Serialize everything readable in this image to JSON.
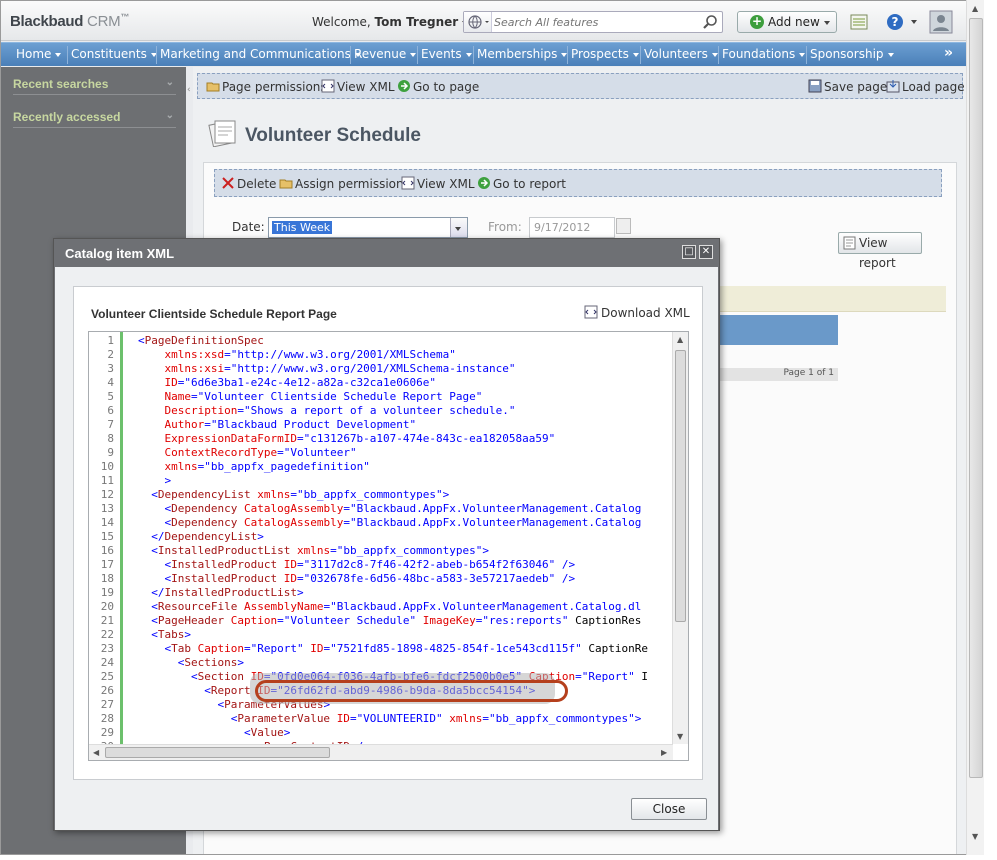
{
  "app": {
    "brand": "Blackbaud",
    "product": "CRM",
    "tm": "™"
  },
  "header": {
    "welcome_prefix": "Welcome,",
    "user_name": "Tom Tregner",
    "search_placeholder": "Search All features",
    "add_new_label": "Add new"
  },
  "nav": {
    "items": [
      "Home",
      "Constituents",
      "Marketing and Communications",
      "Revenue",
      "Events",
      "Memberships",
      "Prospects",
      "Volunteers",
      "Foundations",
      "Sponsorship"
    ],
    "more": "»"
  },
  "sidebar": {
    "recent_searches": "Recent searches",
    "recently_accessed": "Recently accessed"
  },
  "page_toolbar": {
    "permissions": "Page permissions",
    "view_xml": "View XML",
    "go_to_page": "Go to page",
    "save_page": "Save page",
    "load_page": "Load page"
  },
  "page": {
    "title": "Volunteer Schedule"
  },
  "report_toolbar": {
    "delete": "Delete",
    "assign_permissions": "Assign permissions",
    "view_xml": "View XML",
    "go_to_report": "Go to report"
  },
  "filters": {
    "date_label": "Date:",
    "date_value": "This Week",
    "from_label": "From:",
    "from_value": "9/17/2012",
    "view_report": "View report"
  },
  "report": {
    "pager": "Page 1 of 1"
  },
  "dialog": {
    "title": "Catalog item XML",
    "item_name": "Volunteer Clientside Schedule Report Page",
    "download_label": "Download XML",
    "close_label": "Close",
    "lines": [
      "<PageDefinitionSpec",
      "    xmlns:xsd=\"http://www.w3.org/2001/XMLSchema\"",
      "    xmlns:xsi=\"http://www.w3.org/2001/XMLSchema-instance\"",
      "    ID=\"6d6e3ba1-e24c-4e12-a82a-c32ca1e0606e\"",
      "    Name=\"Volunteer Clientside Schedule Report Page\"",
      "    Description=\"Shows a report of a volunteer schedule.\"",
      "    Author=\"Blackbaud Product Development\"",
      "    ExpressionDataFormID=\"c131267b-a107-474e-843c-ea182058aa59\"",
      "    ContextRecordType=\"Volunteer\"",
      "    xmlns=\"bb_appfx_pagedefinition\"",
      "    >",
      "  <DependencyList xmlns=\"bb_appfx_commontypes\">",
      "    <Dependency CatalogAssembly=\"Blackbaud.AppFx.VolunteerManagement.Catalog",
      "    <Dependency CatalogAssembly=\"Blackbaud.AppFx.VolunteerManagement.Catalog",
      "  </DependencyList>",
      "  <InstalledProductList xmlns=\"bb_appfx_commontypes\">",
      "    <InstalledProduct ID=\"3117d2c8-7f46-42f2-abeb-b654f2f63046\" />",
      "    <InstalledProduct ID=\"032678fe-6d56-48bc-a583-3e57217aedeb\" />",
      "  </InstalledProductList>",
      "  <ResourceFile AssemblyName=\"Blackbaud.AppFx.VolunteerManagement.Catalog.dl",
      "  <PageHeader Caption=\"Volunteer Schedule\" ImageKey=\"res:reports\" CaptionRes",
      "  <Tabs>",
      "    <Tab Caption=\"Report\" ID=\"7521fd85-1898-4825-854f-1ce543cd115f\" CaptionRe",
      "      <Sections>",
      "        <Section ID=\"0fd0e064-f036-4afb-bfe6-fdcf2500b0e5\" Caption=\"Report\" I",
      "          <Report ID=\"26fd62fd-abd9-4986-b9da-8da5bcc54154\">",
      "            <ParameterValues>",
      "              <ParameterValue ID=\"VOLUNTEERID\" xmlns=\"bb_appfx_commontypes\">",
      "                <Value>",
      "                  <PageContextID />"
    ]
  },
  "colors": {
    "nav": "#5a8ec5",
    "sidebar": "#6d6f72",
    "dialog": "#6e7074",
    "gutter": "#6cc06c",
    "highlight_ring": "#b5401d"
  }
}
